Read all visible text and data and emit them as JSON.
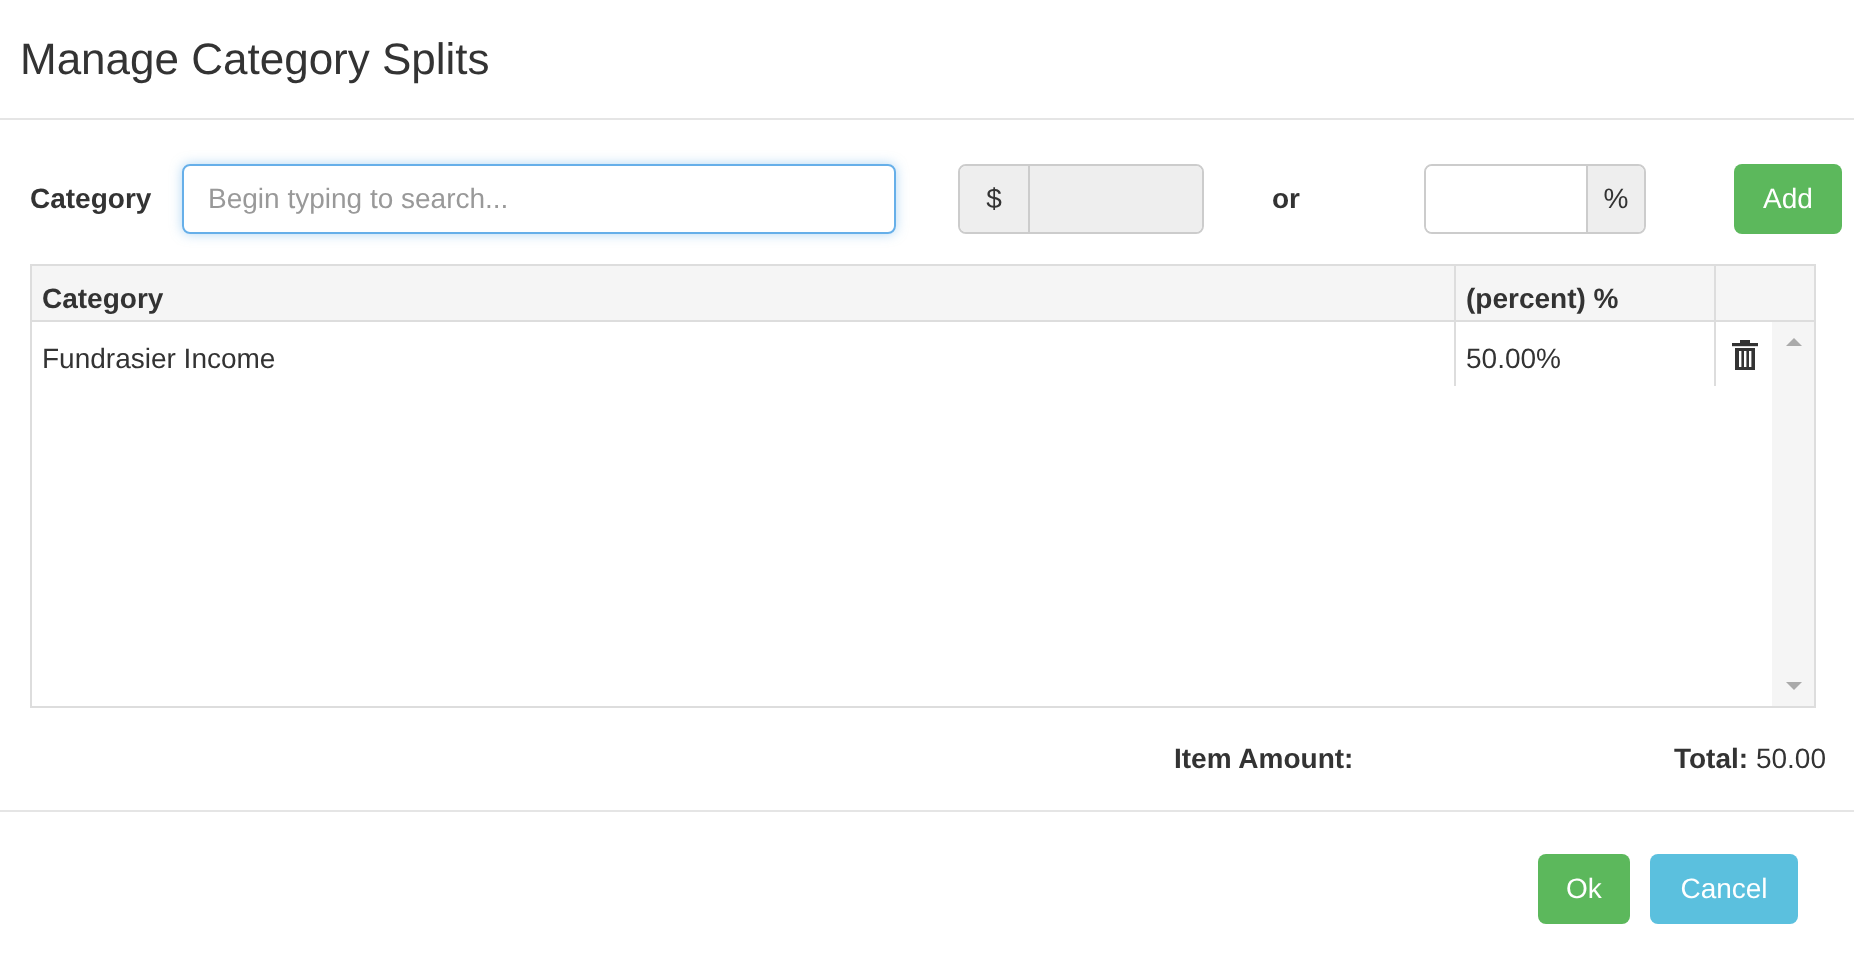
{
  "dialog": {
    "title": "Manage Category Splits"
  },
  "form": {
    "category_label": "Category",
    "search": {
      "placeholder": "Begin typing to search..."
    },
    "amount_prefix": "$",
    "or_label": "or",
    "percent_suffix": "%",
    "add_button": "Add"
  },
  "table": {
    "columns": [
      "Category",
      "(percent) %"
    ],
    "rows": [
      {
        "category": "Fundrasier Income",
        "percent": "50.00%"
      }
    ]
  },
  "summary": {
    "item_amount_label": "Item Amount:",
    "total": "**Total:** 50.00"
  },
  "buttons": [
    "Ok",
    "Cancel"
  ]
}
